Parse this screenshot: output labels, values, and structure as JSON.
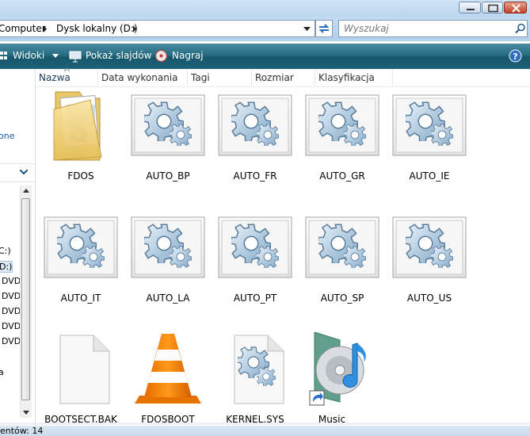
{
  "address": {
    "crumbs": [
      "Computer",
      "Dysk lokalny (D:)"
    ]
  },
  "search": {
    "placeholder": "Wyszukaj"
  },
  "toolbar": {
    "views_label": "Widoki",
    "slideshow_label": "Pokaż slajdów",
    "burn_label": "Nagraj"
  },
  "left_pane": {
    "link_fragment": "one",
    "drives": [
      "C:)",
      "D:)",
      "DVD",
      "DVD",
      "DVD",
      "DVD",
      "DVD"
    ],
    "bottom_fragment": "a"
  },
  "columns": [
    "Nazwa",
    "Data wykonania",
    "Tagi",
    "Rozmiar",
    "Klasyfikacja"
  ],
  "items": [
    {
      "name": "FDOS",
      "icon": "folder-icon"
    },
    {
      "name": "AUTO_BP",
      "icon": "gear-file-icon"
    },
    {
      "name": "AUTO_FR",
      "icon": "gear-file-icon"
    },
    {
      "name": "AUTO_GR",
      "icon": "gear-file-icon"
    },
    {
      "name": "AUTO_IE",
      "icon": "gear-file-icon"
    },
    {
      "name": "AUTO_IT",
      "icon": "gear-file-icon"
    },
    {
      "name": "AUTO_LA",
      "icon": "gear-file-icon"
    },
    {
      "name": "AUTO_PT",
      "icon": "gear-file-icon"
    },
    {
      "name": "AUTO_SP",
      "icon": "gear-file-icon"
    },
    {
      "name": "AUTO_US",
      "icon": "gear-file-icon"
    },
    {
      "name": "BOOTSECT.BAK",
      "icon": "blank-file-icon"
    },
    {
      "name": "FDOSBOOT",
      "icon": "vlc-cone-icon"
    },
    {
      "name": "KERNEL.SYS",
      "icon": "system-file-icon"
    },
    {
      "name": "Music",
      "icon": "music-shortcut-icon"
    }
  ],
  "status": {
    "text": "entów: 14"
  }
}
